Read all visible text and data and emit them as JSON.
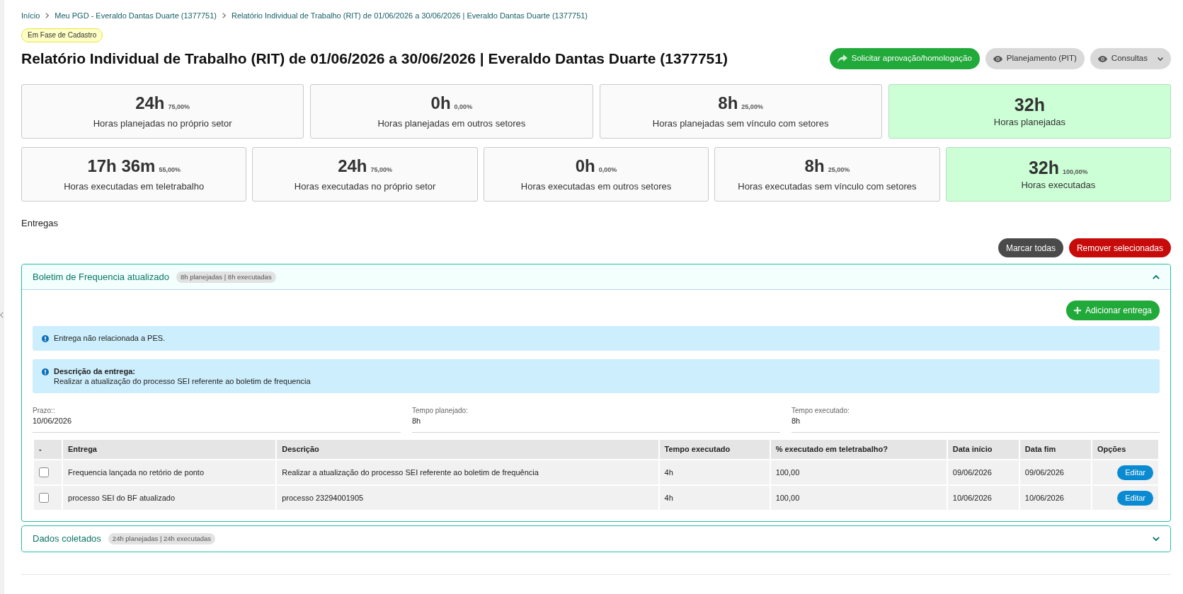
{
  "breadcrumb": [
    "Início",
    "Meu PGD - Everaldo Dantas Duarte (1377751)",
    "Relatório Individual de Trabalho (RIT) de 01/06/2026 a 30/06/2026 | Everaldo Dantas Duarte (1377751)"
  ],
  "status_badge": "Em Fase de Cadastro",
  "title": "Relatório Individual de Trabalho (RIT) de 01/06/2026 a 30/06/2026 | Everaldo Dantas Duarte (1377751)",
  "header_actions": [
    {
      "label": "Solicitar aprovação/homologação",
      "kind": "submit"
    },
    {
      "label": "Planejamento (PIT)",
      "kind": "view"
    },
    {
      "label": "Consultas",
      "kind": "menu"
    }
  ],
  "planned_stats": [
    {
      "value": "24h",
      "percent": "75,00%",
      "label": "Horas planejadas no próprio setor",
      "kind": "part"
    },
    {
      "value": "0h",
      "percent": "0,00%",
      "label": "Horas planejadas em outros setores",
      "kind": "part"
    },
    {
      "value": "8h",
      "percent": "25,00%",
      "label": "Horas planejadas sem vínculo com setores",
      "kind": "part"
    },
    {
      "value": "32h",
      "label": "Horas planejadas",
      "kind": "total"
    }
  ],
  "executed_stats": [
    {
      "value": "17h 36m",
      "percent": "55,00%",
      "label": "Horas executadas em teletrabalho",
      "kind": "part"
    },
    {
      "value": "24h",
      "percent": "75,00%",
      "label": "Horas executadas no próprio setor",
      "kind": "part"
    },
    {
      "value": "0h",
      "percent": "0,00%",
      "label": "Horas executadas em outros setores",
      "kind": "part"
    },
    {
      "value": "8h",
      "percent": "25,00%",
      "label": "Horas executadas sem vínculo com setores",
      "kind": "part"
    },
    {
      "value": "32h",
      "percent": "100,00%",
      "label": "Horas executadas",
      "kind": "total"
    }
  ],
  "section_title": "Entregas",
  "bulk_actions": [
    {
      "label": "Marcar todas",
      "kind": "mark"
    },
    {
      "label": "Remover selecionadas",
      "kind": "remove"
    }
  ],
  "deliveries": [
    {
      "title": "Boletim de Frequencia atualizado",
      "summary": "8h planejadas | 8h executadas",
      "expanded": true,
      "add_button": "Adicionar entrega",
      "alerts": [
        {
          "text": "Entrega não relacionada a PES."
        },
        {
          "heading": "Descrição da entrega:",
          "text": "Realizar a atualização do processo SEI referente ao boletim de frequencia"
        }
      ],
      "fields": [
        {
          "label": "Prazo::",
          "value": "10/06/2026"
        },
        {
          "label": "Tempo planejado:",
          "value": "8h"
        },
        {
          "label": "Tempo executado:",
          "value": "8h"
        }
      ],
      "table": {
        "columns": [
          "-",
          "Entrega",
          "Descrição",
          "Tempo executado",
          "% executado em teletrabalho?",
          "Data início",
          "Data fim",
          "Opções"
        ],
        "rows": [
          {
            "checked": false,
            "cells": [
              "",
              "Frequencia lançada no retório de ponto",
              "Realizar a atualização do processo SEI referente ao boletim de frequência",
              "4h",
              "100,00",
              "09/06/2026",
              "09/06/2026",
              "Editar"
            ]
          },
          {
            "checked": false,
            "cells": [
              "",
              "processo SEI do BF atualizado",
              "processo 23294001905",
              "4h",
              "100,00",
              "10/06/2026",
              "10/06/2026",
              "Editar"
            ]
          }
        ]
      }
    },
    {
      "title": "Dados coletados",
      "summary": "24h planejadas | 24h executadas",
      "expanded": false
    }
  ]
}
